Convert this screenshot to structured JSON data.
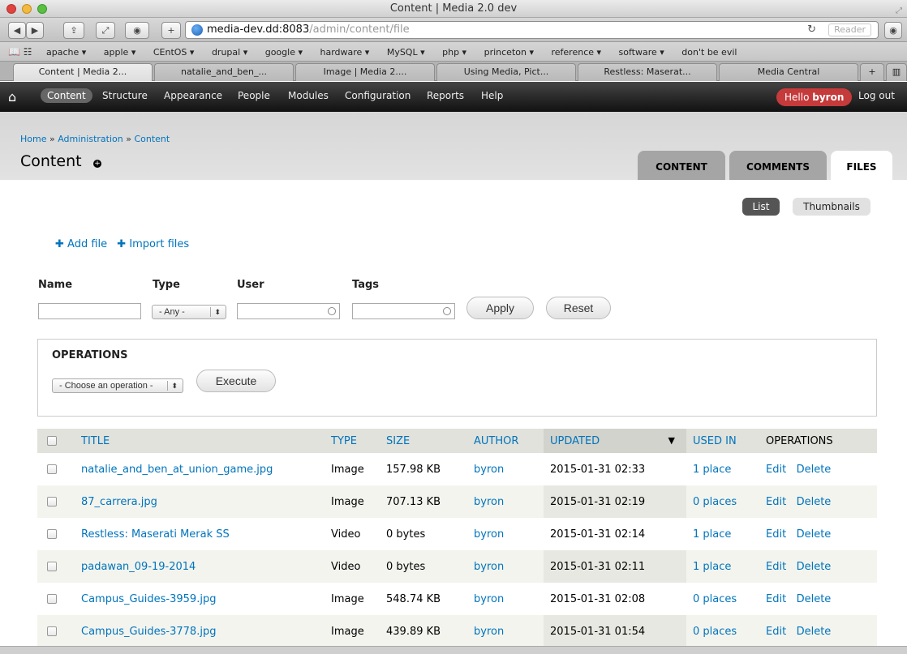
{
  "window": {
    "title": "Content | Media 2.0 dev"
  },
  "toolbar": {
    "url_host": "media-dev.dd:8083",
    "url_path": "/admin/content/file",
    "reader_label": "Reader"
  },
  "bookmarks": [
    "apache ▾",
    "apple ▾",
    "CEntOS ▾",
    "drupal ▾",
    "google ▾",
    "hardware ▾",
    "MySQL ▾",
    "php ▾",
    "princeton ▾",
    "reference ▾",
    "software ▾",
    "don't be evil"
  ],
  "browser_tabs": [
    "Content | Media 2...",
    "natalie_and_ben_...",
    "Image | Media 2....",
    "Using Media, Pict...",
    "Restless: Maserat...",
    "Media Central"
  ],
  "admin_menu": {
    "items": [
      "Content",
      "Structure",
      "Appearance",
      "People",
      "Modules",
      "Configuration",
      "Reports",
      "Help"
    ],
    "hello": "Hello",
    "user": "byron",
    "logout": "Log out"
  },
  "breadcrumb": [
    "Home",
    "Administration",
    "Content"
  ],
  "page": {
    "title": "Content"
  },
  "page_tabs": [
    "CONTENT",
    "COMMENTS",
    "FILES"
  ],
  "view_toggle": {
    "list": "List",
    "thumbnails": "Thumbnails"
  },
  "actions": {
    "add_file": "Add file",
    "import_files": "Import files"
  },
  "filters": {
    "name_label": "Name",
    "type_label": "Type",
    "user_label": "User",
    "tags_label": "Tags",
    "type_value": "- Any -",
    "apply": "Apply",
    "reset": "Reset"
  },
  "operations": {
    "title": "OPERATIONS",
    "select_value": "- Choose an operation -",
    "execute": "Execute"
  },
  "table": {
    "headers": [
      "TITLE",
      "TYPE",
      "SIZE",
      "AUTHOR",
      "UPDATED",
      "USED IN",
      "OPERATIONS"
    ],
    "rows": [
      {
        "title": "natalie_and_ben_at_union_game.jpg",
        "type": "Image",
        "size": "157.98 KB",
        "author": "byron",
        "updated": "2015-01-31 02:33",
        "used_in": "1 place",
        "edit": "Edit",
        "delete": "Delete"
      },
      {
        "title": "87_carrera.jpg",
        "type": "Image",
        "size": "707.13 KB",
        "author": "byron",
        "updated": "2015-01-31 02:19",
        "used_in": "0 places",
        "edit": "Edit",
        "delete": "Delete"
      },
      {
        "title": "Restless: Maserati Merak SS",
        "type": "Video",
        "size": "0 bytes",
        "author": "byron",
        "updated": "2015-01-31 02:14",
        "used_in": "1 place",
        "edit": "Edit",
        "delete": "Delete"
      },
      {
        "title": "padawan_09-19-2014",
        "type": "Video",
        "size": "0 bytes",
        "author": "byron",
        "updated": "2015-01-31 02:11",
        "used_in": "1 place",
        "edit": "Edit",
        "delete": "Delete"
      },
      {
        "title": "Campus_Guides-3959.jpg",
        "type": "Image",
        "size": "548.74 KB",
        "author": "byron",
        "updated": "2015-01-31 02:08",
        "used_in": "0 places",
        "edit": "Edit",
        "delete": "Delete"
      },
      {
        "title": "Campus_Guides-3778.jpg",
        "type": "Image",
        "size": "439.89 KB",
        "author": "byron",
        "updated": "2015-01-31 01:54",
        "used_in": "0 places",
        "edit": "Edit",
        "delete": "Delete"
      }
    ]
  }
}
